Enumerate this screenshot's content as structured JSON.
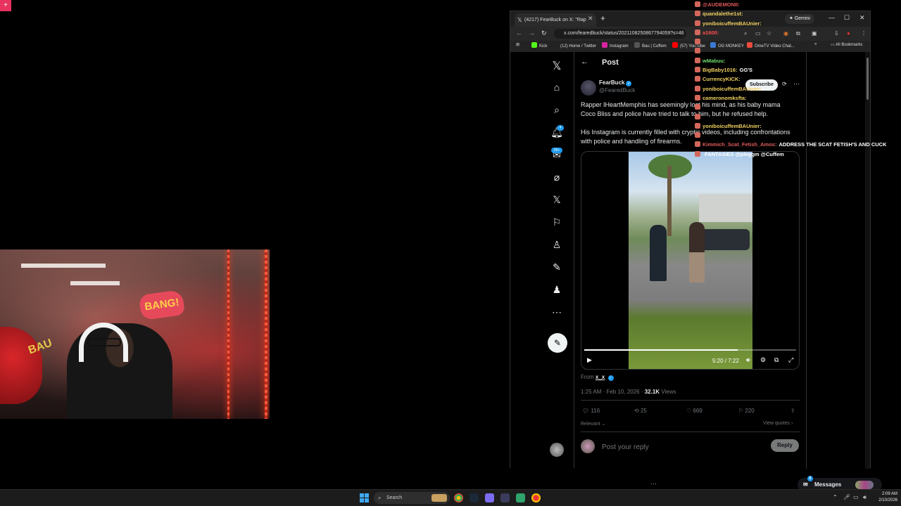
{
  "overlay": {
    "badge_text": "+"
  },
  "webcam": {
    "sign_text": "BANG!",
    "shirt_text": "BAU"
  },
  "browser": {
    "tab_title": "(4217) FearBuck on X: \"Rap",
    "gemini_label": "Gemini",
    "url": "x.com/fearedbuck/status/2021108250867794059?s=46",
    "bookmarks": [
      {
        "label": "Kick",
        "color": "#53fc18"
      },
      {
        "label": "(12) Home / Twitter",
        "color": "#222222"
      },
      {
        "label": "Instagram",
        "color": "#d6249f"
      },
      {
        "label": "Bau | Cuffem",
        "color": "#555555"
      },
      {
        "label": "(57) YouTube",
        "color": "#ff0000"
      },
      {
        "label": "OG MONKEY",
        "color": "#3a7bd5"
      },
      {
        "label": "OmeTV Video Chat...",
        "color": "#e94b3c"
      }
    ],
    "all_bookmarks": "All Bookmarks"
  },
  "x_nav": {
    "notifications_badge": "4",
    "messages_badge": "20+"
  },
  "post": {
    "header": "Post",
    "author_name": "FearBuck",
    "author_handle": "@FearedBuck",
    "subscribe_label": "Subscribe",
    "text_p1": "Rapper IHeartMemphis has seemingly lost his mind, as his baby mama Coco Bliss and police have tried to talk to him, but he refused help.",
    "text_p2": "His Instagram is currently filled with cryptic videos, including confrontations with police and handling of firearms.",
    "video": {
      "timecode": "5:20 / 7:22",
      "progress": 0.724
    },
    "from_label": "From",
    "from_user": "x_x",
    "time": "1:25 AM · Feb 10, 2026 ·",
    "views_count": "32.1K",
    "views_label": "Views",
    "stats": {
      "replies": "116",
      "reposts": "25",
      "likes": "669",
      "bookmarks": "220"
    },
    "relevant_label": "Relevant",
    "view_quotes_label": "View quotes",
    "reply_placeholder": "Post your reply",
    "reply_button": "Reply"
  },
  "chat": [
    {
      "user": "@AUDEMONII:",
      "msg": "",
      "color": "#e05a5a"
    },
    {
      "user": "quandalethe1st:",
      "msg": "",
      "color": "#f0d060"
    },
    {
      "user": "yoniboicuffemBAUnier:",
      "msg": "",
      "color": "#f0d060"
    },
    {
      "user": "a1600:",
      "msg": "",
      "color": "#ff4f4f"
    },
    {
      "user": "",
      "msg": "",
      "color": "#e05a5a"
    },
    {
      "user": "",
      "msg": "",
      "color": "#e05a5a"
    },
    {
      "user": "wMabuu:",
      "msg": "",
      "color": "#6fdc6f"
    },
    {
      "user": "BigBaby1016:",
      "msg": "GG'S",
      "color": "#f0d060"
    },
    {
      "user": "CurrencyKICK:",
      "msg": "",
      "color": "#f0d060"
    },
    {
      "user": "yoniboicuffemBAUnier:",
      "msg": "",
      "color": "#f0d060"
    },
    {
      "user": "cameronomksfta:",
      "msg": "",
      "color": "#f0d060"
    },
    {
      "user": "",
      "msg": "",
      "color": "#e05a5a"
    },
    {
      "user": "",
      "msg": "",
      "color": "#e05a5a"
    },
    {
      "user": "yoniboicuffemBAUnier:",
      "msg": "",
      "color": "#f0d060"
    },
    {
      "user": "",
      "msg": "",
      "color": "#e05a5a"
    },
    {
      "user": "Kimmich_Scat_Fetish_Amos:",
      "msg": "ADDRESS THE SCAT FETISH'S AND CUCK",
      "color": "#e05a5a"
    },
    {
      "user": "",
      "msg": "FANTASIES @pleggm @Cuffem",
      "color": "#ffffff"
    }
  ],
  "bottom": {
    "messages_label": "Messages",
    "messages_badge": "6"
  },
  "taskbar": {
    "search_label": "Search",
    "time": "2:09 AM",
    "date": "2/10/2026"
  }
}
